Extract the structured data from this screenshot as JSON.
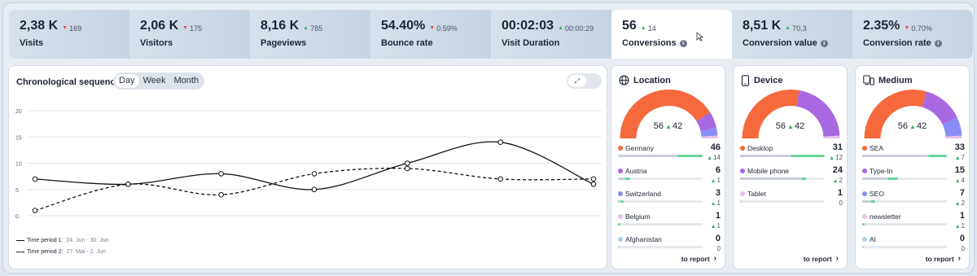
{
  "kpis": [
    {
      "value": "2,38 K",
      "delta": "169",
      "dir": "down",
      "label": "Visits",
      "info": false
    },
    {
      "value": "2,06 K",
      "delta": "175",
      "dir": "down",
      "label": "Visitors",
      "info": false
    },
    {
      "value": "8,16 K",
      "delta": "785",
      "dir": "up",
      "label": "Pageviews",
      "info": false
    },
    {
      "value": "54.40%",
      "delta": "0.59%",
      "dir": "down",
      "label": "Bounce rate",
      "info": false
    },
    {
      "value": "00:02:03",
      "delta": "00:00:29",
      "dir": "up",
      "label": "Visit Duration",
      "info": false
    },
    {
      "value": "56",
      "delta": "14",
      "dir": "up",
      "label": "Conversions",
      "info": true,
      "active": true
    },
    {
      "value": "8,51 K",
      "delta": "70,3",
      "dir": "up",
      "label": "Conversion value",
      "info": true
    },
    {
      "value": "2.35%",
      "delta": "0.70%",
      "dir": "down",
      "label": "Conversion rate",
      "info": true
    }
  ],
  "chart": {
    "title": "Chronological sequence",
    "granularity": [
      "Day",
      "Week",
      "Month"
    ],
    "selected_granularity": "Day",
    "legend": [
      {
        "label": "Time period 1:",
        "dates": "24. Jun - 30. Jun",
        "style": "solid"
      },
      {
        "label": "Time period 2:",
        "dates": "27. Mai - 2. Jun",
        "style": "dashed"
      }
    ]
  },
  "chart_data": {
    "type": "line",
    "y_ticks": [
      0,
      5,
      10,
      15,
      20
    ],
    "ylim": [
      0,
      20
    ],
    "x_count": 7,
    "grid": true,
    "series": [
      {
        "name": "Time period 1",
        "values": [
          7,
          6,
          8,
          5,
          10,
          14,
          6
        ],
        "style": "solid"
      },
      {
        "name": "Time period 2",
        "values": [
          1,
          6,
          4,
          8,
          9,
          7,
          7
        ],
        "style": "dashed"
      }
    ]
  },
  "cards": [
    {
      "title": "Location",
      "icon": "globe-icon",
      "total": "56",
      "delta": "42",
      "segments": [
        {
          "value": 46,
          "color": "#f5693d"
        },
        {
          "value": 6,
          "color": "#a868e0"
        },
        {
          "value": 3,
          "color": "#8a8df5"
        },
        {
          "value": 1,
          "color": "#e9c2ee"
        }
      ],
      "items": [
        {
          "name": "Germany",
          "value": "46",
          "delta": "14",
          "dir": "up",
          "color": "#f5693d",
          "base": 0.7,
          "fill": 0.3
        },
        {
          "name": "Austria",
          "value": "6",
          "delta": "1",
          "dir": "up",
          "color": "#a868e0",
          "base": 0.08,
          "fill": 0.06
        },
        {
          "name": "Switzerland",
          "value": "3",
          "delta": "1",
          "dir": "up",
          "color": "#8a8df5",
          "base": 0.03,
          "fill": 0.04
        },
        {
          "name": "Belgium",
          "value": "1",
          "delta": "1",
          "dir": "up",
          "color": "#e9c2ee",
          "base": 0.0,
          "fill": 0.03
        },
        {
          "name": "Afghanistan",
          "value": "0",
          "delta": "0",
          "dir": "none",
          "color": "#a9cdf0",
          "base": 0.02,
          "fill": 0.0
        }
      ],
      "link": "to report"
    },
    {
      "title": "Device",
      "icon": "smartphone-icon",
      "total": "56",
      "delta": "42",
      "segments": [
        {
          "value": 31,
          "color": "#f5693d"
        },
        {
          "value": 24,
          "color": "#a868e0"
        },
        {
          "value": 1,
          "color": "#e9c2ee"
        }
      ],
      "items": [
        {
          "name": "Desktop",
          "value": "31",
          "delta": "12",
          "dir": "up",
          "color": "#f5693d",
          "base": 0.6,
          "fill": 0.4
        },
        {
          "name": "Mobile phone",
          "value": "24",
          "delta": "2",
          "dir": "up",
          "color": "#a868e0",
          "base": 0.72,
          "fill": 0.06
        },
        {
          "name": "Tablet",
          "value": "1",
          "delta": "0",
          "dir": "none",
          "color": "#e9c2ee",
          "base": 0.02,
          "fill": 0.0
        }
      ],
      "link": "to report"
    },
    {
      "title": "Medium",
      "icon": "devices-icon",
      "total": "56",
      "delta": "42",
      "segments": [
        {
          "value": 33,
          "color": "#f5693d"
        },
        {
          "value": 15,
          "color": "#a868e0"
        },
        {
          "value": 7,
          "color": "#8a8df5"
        },
        {
          "value": 1,
          "color": "#e9c2ee"
        }
      ],
      "items": [
        {
          "name": "SEA",
          "value": "33",
          "delta": "7",
          "dir": "up",
          "color": "#f5693d",
          "base": 0.78,
          "fill": 0.22
        },
        {
          "name": "Type-In",
          "value": "15",
          "delta": "4",
          "dir": "up",
          "color": "#a868e0",
          "base": 0.3,
          "fill": 0.12
        },
        {
          "name": "SEO",
          "value": "7",
          "delta": "2",
          "dir": "up",
          "color": "#8a8df5",
          "base": 0.1,
          "fill": 0.05
        },
        {
          "name": "newsletter",
          "value": "1",
          "delta": "1",
          "dir": "up",
          "color": "#e9c2ee",
          "base": 0.0,
          "fill": 0.03
        },
        {
          "name": "AI",
          "value": "0",
          "delta": "0",
          "dir": "none",
          "color": "#a9cdf0",
          "base": 0.02,
          "fill": 0.0
        }
      ],
      "link": "to report"
    }
  ]
}
